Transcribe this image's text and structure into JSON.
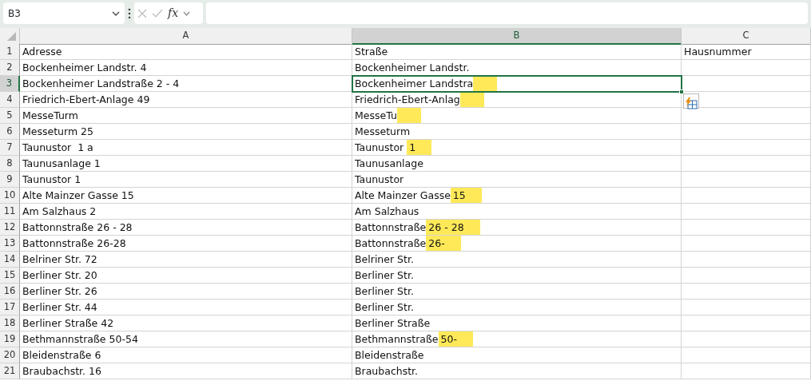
{
  "formula_bar": {
    "name_box": "B3",
    "function_label": "fx"
  },
  "columns": [
    {
      "label": "A",
      "selected": false
    },
    {
      "label": "B",
      "selected": true
    },
    {
      "label": "C",
      "selected": false
    }
  ],
  "rows": [
    {
      "number": "1",
      "selected": false,
      "cells": [
        {
          "text": "Adresse"
        },
        {
          "text": "Straße"
        },
        {
          "text": "Hausnummer"
        }
      ]
    },
    {
      "number": "2",
      "selected": false,
      "cells": [
        {
          "text": "Bockenheimer Landstr. 4"
        },
        {
          "text": "Bockenheimer Landstr."
        }
      ]
    },
    {
      "number": "3",
      "selected": true,
      "cells": [
        {
          "text": "Bockenheimer Landstraße 2 - 4"
        },
        {
          "text": "Bockenheimer Landstra",
          "flash_fill": true,
          "active": true
        }
      ]
    },
    {
      "number": "4",
      "selected": false,
      "cells": [
        {
          "text": "Friedrich-Ebert-Anlage 49"
        },
        {
          "text": "Friedrich-Ebert-Anlag",
          "flash_fill": true
        }
      ]
    },
    {
      "number": "5",
      "selected": false,
      "cells": [
        {
          "text": "MesseTurm"
        },
        {
          "text": "MesseTu",
          "flash_fill": true
        }
      ]
    },
    {
      "number": "6",
      "selected": false,
      "cells": [
        {
          "text": "Messeturm 25"
        },
        {
          "text": "Messeturm"
        }
      ]
    },
    {
      "number": "7",
      "selected": false,
      "cells": [
        {
          "text": "Taunustor  1 a"
        },
        {
          "text": "Taunustor ",
          "flash_fill": true,
          "flash_text": "1"
        }
      ]
    },
    {
      "number": "8",
      "selected": false,
      "cells": [
        {
          "text": "Taunusanlage 1"
        },
        {
          "text": "Taunusanlage"
        }
      ]
    },
    {
      "number": "9",
      "selected": false,
      "cells": [
        {
          "text": "Taunustor 1"
        },
        {
          "text": "Taunustor"
        }
      ]
    },
    {
      "number": "10",
      "selected": false,
      "cells": [
        {
          "text": "Alte Mainzer Gasse 15"
        },
        {
          "text": "Alte Mainzer Gasse",
          "flash_fill": true,
          "flash_text": "15"
        }
      ]
    },
    {
      "number": "11",
      "selected": false,
      "cells": [
        {
          "text": "Am Salzhaus 2"
        },
        {
          "text": "Am Salzhaus"
        }
      ]
    },
    {
      "number": "12",
      "selected": false,
      "cells": [
        {
          "text": "Battonnstraße 26 - 28"
        },
        {
          "text": "Battonnstraße",
          "flash_fill": true,
          "flash_text": "26 - 28"
        }
      ]
    },
    {
      "number": "13",
      "selected": false,
      "cells": [
        {
          "text": "Battonnstraße 26-28"
        },
        {
          "text": "Battonnstraße",
          "flash_fill": true,
          "flash_text": "26-"
        }
      ]
    },
    {
      "number": "14",
      "selected": false,
      "cells": [
        {
          "text": "Belriner Str. 72"
        },
        {
          "text": "Belriner Str."
        }
      ]
    },
    {
      "number": "15",
      "selected": false,
      "cells": [
        {
          "text": "Berliner Str. 20"
        },
        {
          "text": "Berliner Str."
        }
      ]
    },
    {
      "number": "16",
      "selected": false,
      "cells": [
        {
          "text": "Berliner Str. 26"
        },
        {
          "text": "Berliner Str."
        }
      ]
    },
    {
      "number": "17",
      "selected": false,
      "cells": [
        {
          "text": "Berliner Str. 44"
        },
        {
          "text": "Berliner Str."
        }
      ]
    },
    {
      "number": "18",
      "selected": false,
      "cells": [
        {
          "text": "Berliner Straße 42"
        },
        {
          "text": "Berliner Straße"
        }
      ]
    },
    {
      "number": "19",
      "selected": false,
      "cells": [
        {
          "text": "Bethmannstraße 50-54"
        },
        {
          "text": "Bethmannstraße",
          "flash_fill": true,
          "flash_text": "50-"
        }
      ]
    },
    {
      "number": "20",
      "selected": false,
      "cells": [
        {
          "text": "Bleidenstraße 6"
        },
        {
          "text": "Bleidenstraße"
        }
      ]
    },
    {
      "number": "21",
      "selected": false,
      "cells": [
        {
          "text": "Braubachstr. 16"
        },
        {
          "text": "Braubachstr."
        }
      ]
    }
  ]
}
